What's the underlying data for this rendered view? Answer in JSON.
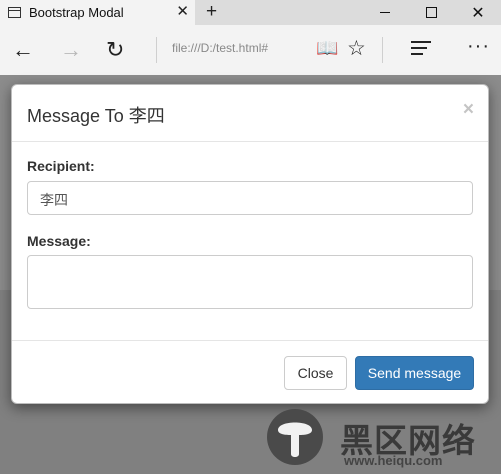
{
  "browser": {
    "tab_title": "Bootstrap Modal",
    "tab_close_glyph": "✕",
    "new_tab_glyph": "+",
    "window_close_glyph": "✕",
    "back_glyph": "←",
    "forward_glyph": "→",
    "refresh_glyph": "↻",
    "address": "file:///D:/test.html#",
    "reading_view_glyph": "📖",
    "favorite_glyph": "☆",
    "more_glyph": "···"
  },
  "modal": {
    "title": "Message To 李四",
    "close_glyph": "×",
    "recipient_label": "Recipient:",
    "recipient_value": "李四",
    "message_label": "Message:",
    "message_value": "",
    "close_button": "Close",
    "send_button": "Send message"
  },
  "watermark": {
    "name": "黑区网络",
    "url": "www.heiqu.com"
  }
}
